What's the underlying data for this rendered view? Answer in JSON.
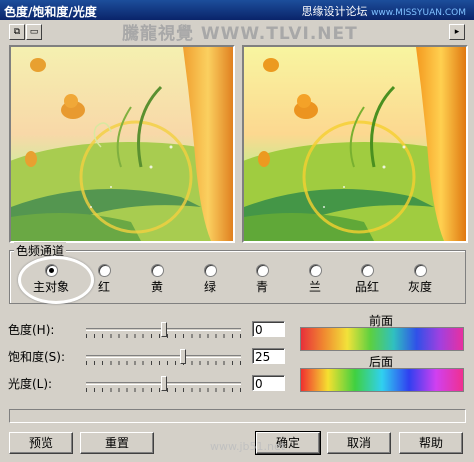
{
  "window": {
    "title": "色度/饱和度/光度"
  },
  "watermarks": {
    "forum": "思缘设计论坛",
    "forum_url": "www.MISSYUAN.COM",
    "center": "騰龍視覺 WWW.TLVI.NET",
    "bottom": "www.jb51.net"
  },
  "toolbar": {
    "button_a_icon": "layout-icon",
    "button_b_icon": "single-view-icon",
    "scroll_icon": "play-arrow-icon",
    "scroll_glyph": "▸"
  },
  "channels": {
    "label": "色频通道",
    "options": [
      {
        "label": "主对象",
        "checked": true
      },
      {
        "label": "红",
        "checked": false
      },
      {
        "label": "黄",
        "checked": false
      },
      {
        "label": "绿",
        "checked": false
      },
      {
        "label": "青",
        "checked": false
      },
      {
        "label": "兰",
        "checked": false
      },
      {
        "label": "品红",
        "checked": false
      },
      {
        "label": "灰度",
        "checked": false
      }
    ]
  },
  "adjustments": {
    "hue": {
      "label": "色度(H):",
      "value": "0"
    },
    "saturation": {
      "label": "饱和度(S):",
      "value": "25"
    },
    "lightness": {
      "label": "光度(L):",
      "value": "0"
    }
  },
  "spectrum": {
    "before_label": "前面",
    "after_label": "后面"
  },
  "buttons": {
    "preview": "预览",
    "reset": "重置",
    "ok": "确定",
    "cancel": "取消",
    "help": "帮助"
  }
}
